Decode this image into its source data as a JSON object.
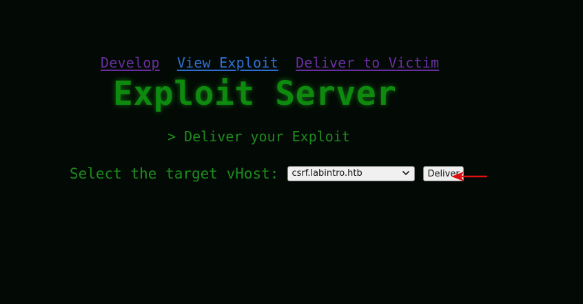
{
  "nav": {
    "links": [
      {
        "label": "Develop"
      },
      {
        "label": "View Exploit"
      },
      {
        "label": "Deliver to Victim"
      }
    ]
  },
  "title": "Exploit Server",
  "subtitle": "> Deliver your Exploit",
  "form": {
    "label": "Select the target vHost:",
    "selected_vhost": "csrf.labintro.htb",
    "button_label": "Deliver"
  },
  "colors": {
    "background": "#030a05",
    "terminal_green": "#1f8a1f",
    "link_visited": "#6a2ea0",
    "link_active": "#2f6fd2",
    "arrow": "#e01010"
  },
  "icons": {
    "select_chevron": "chevron-down-icon",
    "annotation": "arrow-left-icon"
  }
}
